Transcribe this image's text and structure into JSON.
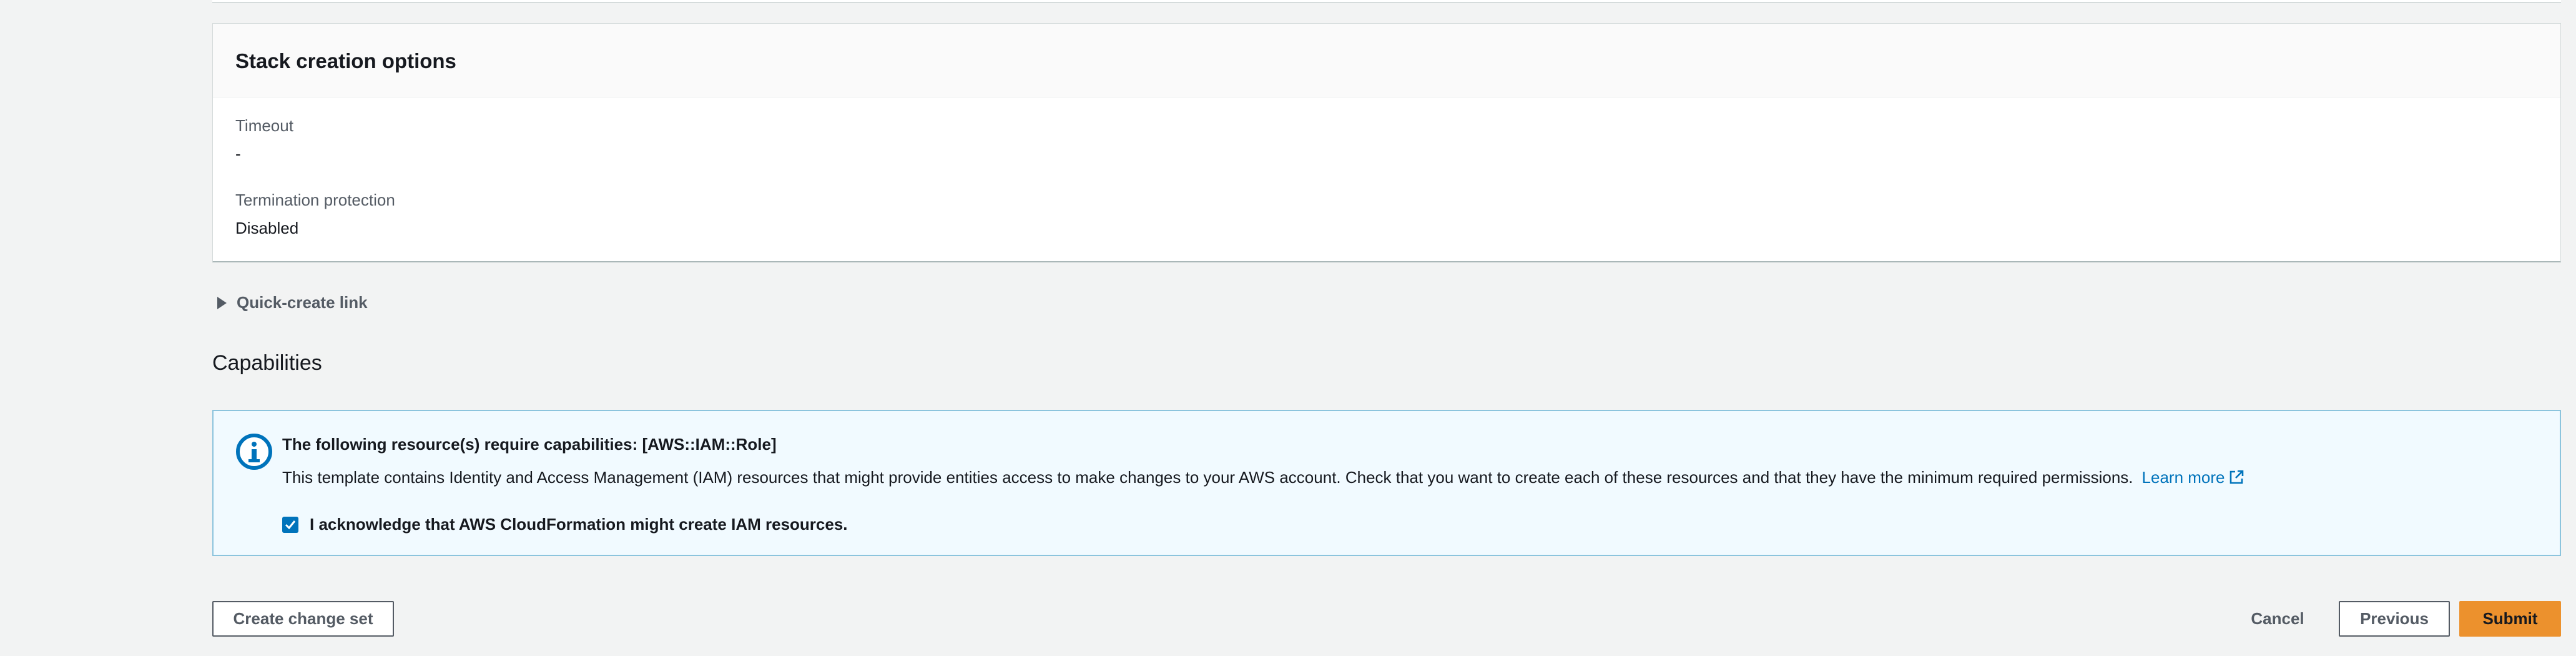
{
  "stack_options": {
    "title": "Stack creation options",
    "timeout_label": "Timeout",
    "timeout_value": "-",
    "termination_label": "Termination protection",
    "termination_value": "Disabled"
  },
  "quick_create": {
    "label": "Quick-create link",
    "icon": "caret-right-icon"
  },
  "capabilities": {
    "title": "Capabilities",
    "alert": {
      "icon": "info-icon",
      "heading": "The following resource(s) require capabilities: [AWS::IAM::Role]",
      "body": "This template contains Identity and Access Management (IAM) resources that might provide entities access to make changes to your AWS account. Check that you want to create each of these resources and that they have the minimum required permissions.",
      "learn_more": "Learn more",
      "learn_more_icon": "external-link-icon",
      "accent_color": "#0073bb",
      "background_color": "#f1faff"
    },
    "acknowledge": {
      "label": "I acknowledge that AWS CloudFormation might create IAM resources.",
      "checked": true
    }
  },
  "footer": {
    "create_change_set": "Create change set",
    "cancel": "Cancel",
    "previous": "Previous",
    "submit": "Submit",
    "primary_color": "#ec912d"
  }
}
